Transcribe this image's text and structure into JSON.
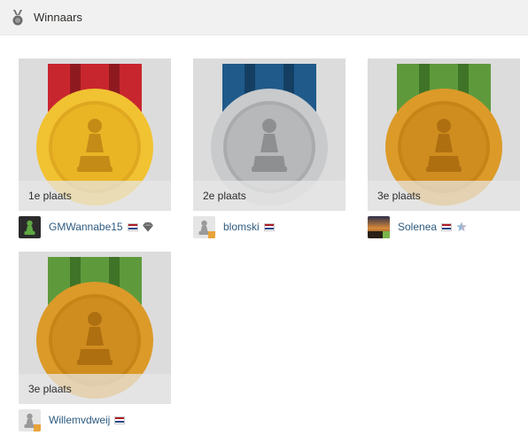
{
  "header": {
    "title": "Winnaars",
    "icon": "medal-icon"
  },
  "colors": {
    "gold": "#f1c232",
    "silver": "#bdbfc1",
    "bronze": "#dc9a29",
    "ribbon_red": "#c8262e",
    "ribbon_blue": "#1f5a8b",
    "ribbon_green": "#5e9a3c",
    "username": "#2e5b80",
    "online_orange": "#e8a33a",
    "online_green": "#7ab44a"
  },
  "winners": [
    {
      "place": "1e plaats",
      "medal": "gold",
      "ribbon": "red",
      "username": "GMWannabe15",
      "flag": "netherlands-flag",
      "badge": "diamond-icon",
      "avatar": "green-pawn-avatar"
    },
    {
      "place": "2e plaats",
      "medal": "silver",
      "ribbon": "blue",
      "username": "blomski",
      "flag": "netherlands-flag",
      "badge": "",
      "avatar": "default-pawn-avatar"
    },
    {
      "place": "3e plaats",
      "medal": "bronze",
      "ribbon": "green",
      "username": "Solenea",
      "flag": "netherlands-flag",
      "badge": "star-icon",
      "avatar": "sunset-photo-avatar"
    },
    {
      "place": "3e plaats",
      "medal": "bronze",
      "ribbon": "green",
      "username": "Willemvdweij",
      "flag": "netherlands-flag",
      "badge": "",
      "avatar": "default-pawn-avatar"
    }
  ]
}
